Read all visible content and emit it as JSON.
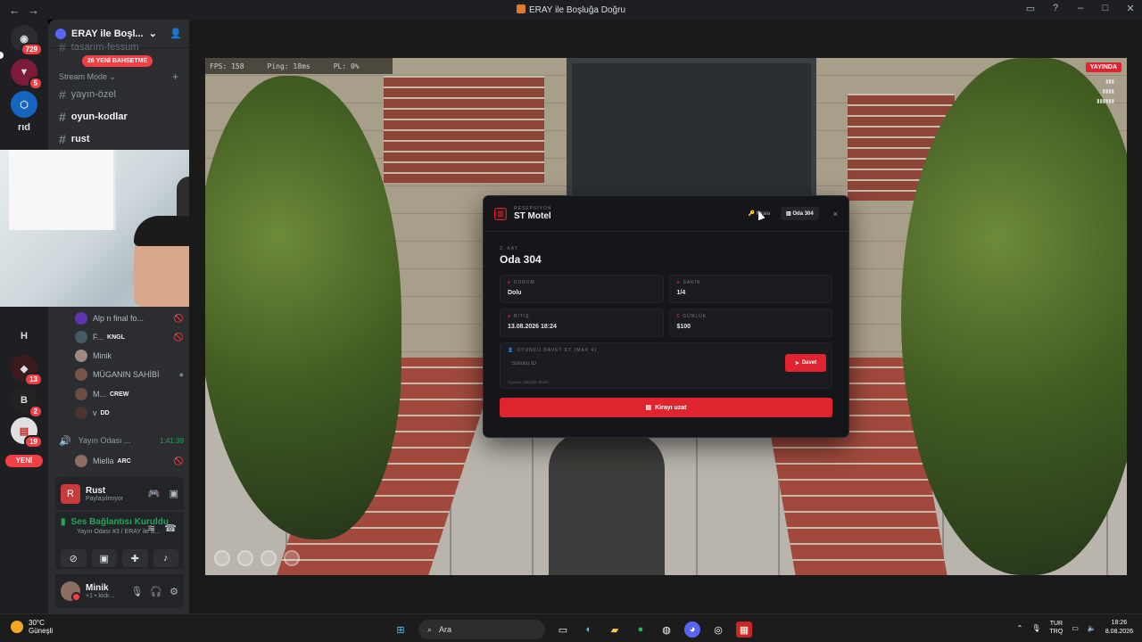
{
  "window": {
    "title": "ERAY ile Boşluğa Doğru",
    "back": "←",
    "forward": "→"
  },
  "rail": {
    "top_badge": "729",
    "badges": [
      "5",
      "13",
      "2",
      "19"
    ],
    "rid_label": "rıd",
    "h_label": "H",
    "new_label": "YENİ"
  },
  "sidebar": {
    "server_name": "ERAY ile Boşl...",
    "new_mentions": "26 YENİ BAHSETME",
    "partial_channel": "tasarım-fessum",
    "category": "Stream Mode",
    "channels": [
      {
        "name": "yayın-özel",
        "bold": false
      },
      {
        "name": "oyun-kodlar",
        "bold": true
      },
      {
        "name": "rust",
        "bold": true
      }
    ],
    "voice_users": [
      {
        "name": "Alp n final fo...",
        "tag": ""
      },
      {
        "name": "F...",
        "tag": "KNGL"
      },
      {
        "name": "Minik",
        "tag": ""
      },
      {
        "name": "MÜGANIN SAHİBİ",
        "tag": ""
      },
      {
        "name": "M...",
        "tag": "CREW"
      },
      {
        "name": "v",
        "tag": "DD"
      }
    ],
    "voice_channel": {
      "name": "Yayın Odası ...",
      "time": "1:41:39"
    },
    "voice_channel_user": {
      "name": "Miella",
      "tag": "ARC"
    }
  },
  "game_panel": {
    "name": "Rust",
    "status": "Paylaşılmıyor"
  },
  "voice_panel": {
    "title": "Ses Bağlantısı Kuruldu",
    "subtitle": "Yayın Odası #3 / ERAY ile B..."
  },
  "user_panel": {
    "name": "Minik",
    "status": "+1 • kick..."
  },
  "stream": {
    "fps": "FPS: 158",
    "ping": "Ping: 18ms",
    "pl": "PL: 0%",
    "live": "YAYINDA"
  },
  "motel": {
    "kicker": "RESEPSİYON",
    "title": "ST Motel",
    "tab_rent": "Kirala",
    "tab_room": "Oda 304",
    "close": "×",
    "floor": "3. KAT",
    "room": "Oda 304",
    "fields": [
      {
        "label": "DURUM",
        "value": "Dolu"
      },
      {
        "label": "SAKİN",
        "value": "1/4"
      },
      {
        "label": "BİTİŞ",
        "value": "13.08.2026 18:24"
      },
      {
        "label": "GÜNLÜK",
        "value": "$100"
      }
    ],
    "invite_label": "OYUNCU DAVET ET (MAX 4)",
    "invite_placeholder": "Sunucu ID",
    "invite_button": "Davet",
    "invite_hint": "Oyuncu yakında olmalı",
    "extend_button": "Kirayı uzat"
  },
  "taskbar": {
    "temp": "30°C",
    "condition": "Güneşli",
    "search": "Ara",
    "lang1": "TUR",
    "lang2": "TRQ",
    "time": "18:26",
    "date": "8.08.2026"
  }
}
